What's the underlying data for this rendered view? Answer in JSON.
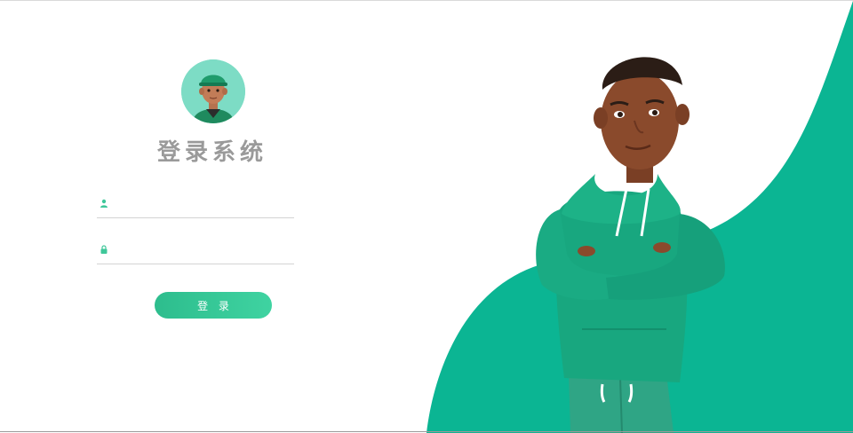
{
  "login": {
    "title": "登录系统",
    "username_placeholder": "",
    "password_placeholder": "",
    "login_button": "登 录"
  },
  "icons": {
    "user": "user-icon",
    "lock": "lock-icon"
  },
  "colors": {
    "accent": "#0bb593",
    "accent_light": "#3fd3a1",
    "title_gray": "#9a9a9a"
  }
}
